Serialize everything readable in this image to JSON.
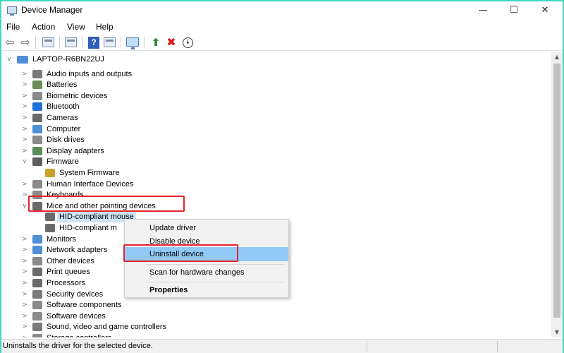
{
  "window": {
    "title": "Device Manager",
    "minimize": "—",
    "maximize": "☐",
    "close": "✕"
  },
  "menu": [
    "File",
    "Action",
    "View",
    "Help"
  ],
  "toolbar": {
    "buttons": [
      "back-icon",
      "forward-icon",
      "show-hide-console-tree-icon",
      "properties-icon",
      "help-icon",
      "action-pane-icon",
      "scan-hardware-changes-icon",
      "add-legacy-hardware-icon",
      "uninstall-device-icon",
      "update-driver-icon"
    ],
    "back_glyph": "⇦",
    "forward_glyph": "⇨",
    "help_glyph": "?",
    "add_glyph": "⬆",
    "x_glyph": "✖",
    "dl_glyph": "↓"
  },
  "tree": {
    "root": "LAPTOP-R6BN22UJ",
    "items": [
      {
        "label": "Audio inputs and outputs",
        "icon": "speaker-icon",
        "color": "#7a7a7a"
      },
      {
        "label": "Batteries",
        "icon": "battery-icon",
        "color": "#6c8c58"
      },
      {
        "label": "Biometric devices",
        "icon": "fingerprint-icon",
        "color": "#8a8a8a"
      },
      {
        "label": "Bluetooth",
        "icon": "bluetooth-icon",
        "color": "#1f6fd6"
      },
      {
        "label": "Cameras",
        "icon": "camera-icon",
        "color": "#6a6a6a"
      },
      {
        "label": "Computer",
        "icon": "computer-icon",
        "color": "#4f8fd6"
      },
      {
        "label": "Disk drives",
        "icon": "disk-drive-icon",
        "color": "#8a8a8a"
      },
      {
        "label": "Display adapters",
        "icon": "display-adapter-icon",
        "color": "#5a8a5a"
      },
      {
        "label": "Firmware",
        "icon": "firmware-icon",
        "color": "#5c5c5c"
      },
      {
        "label": "System Firmware",
        "icon": "chip-icon",
        "color": "#c9a227"
      },
      {
        "label": "Human Interface Devices",
        "icon": "hid-icon",
        "color": "#8a8a8a"
      },
      {
        "label": "Keyboards",
        "icon": "keyboard-icon",
        "color": "#8a8a8a"
      },
      {
        "label": "Mice and other pointing devices",
        "icon": "mouse-icon",
        "color": "#6a6a6a"
      },
      {
        "label": "HID-compliant mouse",
        "icon": "mouse-icon",
        "color": "#6a6a6a"
      },
      {
        "label": "HID-compliant m",
        "icon": "mouse-icon",
        "color": "#6a6a6a"
      },
      {
        "label": "Monitors",
        "icon": "monitor-icon",
        "color": "#4f8fd6"
      },
      {
        "label": "Network adapters",
        "icon": "network-adapter-icon",
        "color": "#4f8fd6"
      },
      {
        "label": "Other devices",
        "icon": "other-devices-icon",
        "color": "#8a8a8a"
      },
      {
        "label": "Print queues",
        "icon": "printer-icon",
        "color": "#6a6a6a"
      },
      {
        "label": "Processors",
        "icon": "processor-icon",
        "color": "#6a6a6a"
      },
      {
        "label": "Security devices",
        "icon": "security-device-icon",
        "color": "#7a7a7a"
      },
      {
        "label": "Software components",
        "icon": "software-component-icon",
        "color": "#8a8a8a"
      },
      {
        "label": "Software devices",
        "icon": "software-device-icon",
        "color": "#8a8a8a"
      },
      {
        "label": "Sound, video and game controllers",
        "icon": "sound-icon",
        "color": "#7a7a7a"
      },
      {
        "label": "Storage controllers",
        "icon": "storage-controller-icon",
        "color": "#8a8a8a"
      }
    ]
  },
  "context_menu": {
    "items": [
      "Update driver",
      "Disable device",
      "Uninstall device",
      "Scan for hardware changes",
      "Properties"
    ],
    "active": "Uninstall device"
  },
  "status": "Uninstalls the driver for the selected device.",
  "colors": {
    "highlight_box": "#e5232b",
    "menu_active": "#91c9f7",
    "selection": "#cce4f7",
    "accent_teal": "#3fd6c2"
  }
}
